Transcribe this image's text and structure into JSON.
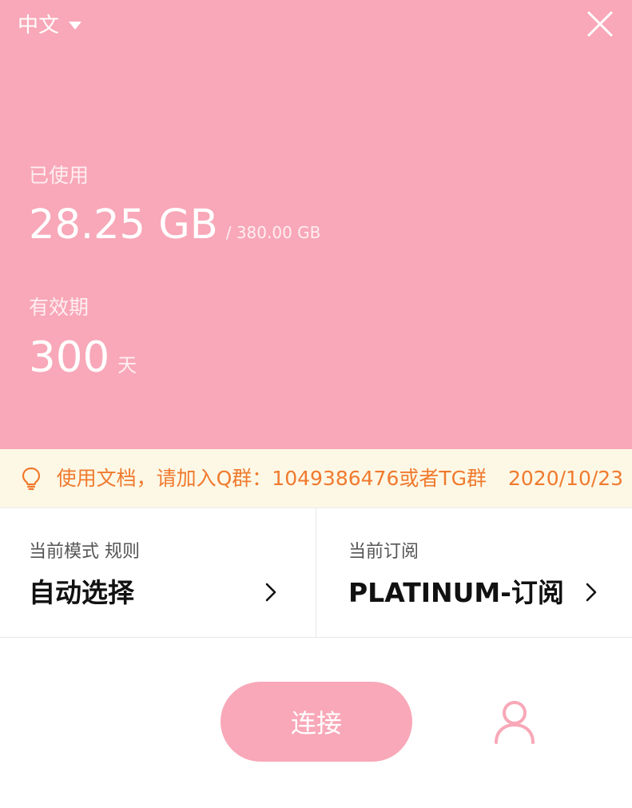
{
  "header": {
    "language_label": "中文",
    "used_label": "已使用",
    "used_value": "28.25 GB",
    "used_total": "/ 380.00 GB",
    "validity_label": "有效期",
    "validity_days": "300",
    "validity_unit": "天"
  },
  "notice": {
    "text": "使用文档，请加入Q群：1049386476或者TG群",
    "date": "2020/10/23"
  },
  "mode": {
    "caption": "当前模式 规则",
    "value": "自动选择"
  },
  "subscription": {
    "caption": "当前订阅",
    "value": "PLATINUM-订阅"
  },
  "actions": {
    "connect_label": "连接"
  },
  "colors": {
    "brand_pink": "#f8a8b8",
    "notice_bg": "#fdf8e6",
    "notice_text": "#f07a2e"
  }
}
